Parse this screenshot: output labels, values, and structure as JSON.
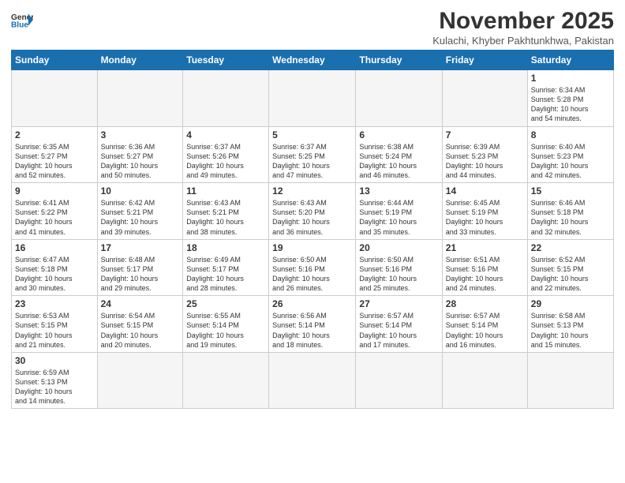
{
  "header": {
    "logo_general": "General",
    "logo_blue": "Blue",
    "month": "November 2025",
    "location": "Kulachi, Khyber Pakhtunkhwa, Pakistan"
  },
  "days_of_week": [
    "Sunday",
    "Monday",
    "Tuesday",
    "Wednesday",
    "Thursday",
    "Friday",
    "Saturday"
  ],
  "weeks": [
    [
      {
        "day": "",
        "info": ""
      },
      {
        "day": "",
        "info": ""
      },
      {
        "day": "",
        "info": ""
      },
      {
        "day": "",
        "info": ""
      },
      {
        "day": "",
        "info": ""
      },
      {
        "day": "",
        "info": ""
      },
      {
        "day": "1",
        "info": "Sunrise: 6:34 AM\nSunset: 5:28 PM\nDaylight: 10 hours\nand 54 minutes."
      }
    ],
    [
      {
        "day": "2",
        "info": "Sunrise: 6:35 AM\nSunset: 5:27 PM\nDaylight: 10 hours\nand 52 minutes."
      },
      {
        "day": "3",
        "info": "Sunrise: 6:36 AM\nSunset: 5:27 PM\nDaylight: 10 hours\nand 50 minutes."
      },
      {
        "day": "4",
        "info": "Sunrise: 6:37 AM\nSunset: 5:26 PM\nDaylight: 10 hours\nand 49 minutes."
      },
      {
        "day": "5",
        "info": "Sunrise: 6:37 AM\nSunset: 5:25 PM\nDaylight: 10 hours\nand 47 minutes."
      },
      {
        "day": "6",
        "info": "Sunrise: 6:38 AM\nSunset: 5:24 PM\nDaylight: 10 hours\nand 46 minutes."
      },
      {
        "day": "7",
        "info": "Sunrise: 6:39 AM\nSunset: 5:23 PM\nDaylight: 10 hours\nand 44 minutes."
      },
      {
        "day": "8",
        "info": "Sunrise: 6:40 AM\nSunset: 5:23 PM\nDaylight: 10 hours\nand 42 minutes."
      }
    ],
    [
      {
        "day": "9",
        "info": "Sunrise: 6:41 AM\nSunset: 5:22 PM\nDaylight: 10 hours\nand 41 minutes."
      },
      {
        "day": "10",
        "info": "Sunrise: 6:42 AM\nSunset: 5:21 PM\nDaylight: 10 hours\nand 39 minutes."
      },
      {
        "day": "11",
        "info": "Sunrise: 6:43 AM\nSunset: 5:21 PM\nDaylight: 10 hours\nand 38 minutes."
      },
      {
        "day": "12",
        "info": "Sunrise: 6:43 AM\nSunset: 5:20 PM\nDaylight: 10 hours\nand 36 minutes."
      },
      {
        "day": "13",
        "info": "Sunrise: 6:44 AM\nSunset: 5:19 PM\nDaylight: 10 hours\nand 35 minutes."
      },
      {
        "day": "14",
        "info": "Sunrise: 6:45 AM\nSunset: 5:19 PM\nDaylight: 10 hours\nand 33 minutes."
      },
      {
        "day": "15",
        "info": "Sunrise: 6:46 AM\nSunset: 5:18 PM\nDaylight: 10 hours\nand 32 minutes."
      }
    ],
    [
      {
        "day": "16",
        "info": "Sunrise: 6:47 AM\nSunset: 5:18 PM\nDaylight: 10 hours\nand 30 minutes."
      },
      {
        "day": "17",
        "info": "Sunrise: 6:48 AM\nSunset: 5:17 PM\nDaylight: 10 hours\nand 29 minutes."
      },
      {
        "day": "18",
        "info": "Sunrise: 6:49 AM\nSunset: 5:17 PM\nDaylight: 10 hours\nand 28 minutes."
      },
      {
        "day": "19",
        "info": "Sunrise: 6:50 AM\nSunset: 5:16 PM\nDaylight: 10 hours\nand 26 minutes."
      },
      {
        "day": "20",
        "info": "Sunrise: 6:50 AM\nSunset: 5:16 PM\nDaylight: 10 hours\nand 25 minutes."
      },
      {
        "day": "21",
        "info": "Sunrise: 6:51 AM\nSunset: 5:16 PM\nDaylight: 10 hours\nand 24 minutes."
      },
      {
        "day": "22",
        "info": "Sunrise: 6:52 AM\nSunset: 5:15 PM\nDaylight: 10 hours\nand 22 minutes."
      }
    ],
    [
      {
        "day": "23",
        "info": "Sunrise: 6:53 AM\nSunset: 5:15 PM\nDaylight: 10 hours\nand 21 minutes."
      },
      {
        "day": "24",
        "info": "Sunrise: 6:54 AM\nSunset: 5:15 PM\nDaylight: 10 hours\nand 20 minutes."
      },
      {
        "day": "25",
        "info": "Sunrise: 6:55 AM\nSunset: 5:14 PM\nDaylight: 10 hours\nand 19 minutes."
      },
      {
        "day": "26",
        "info": "Sunrise: 6:56 AM\nSunset: 5:14 PM\nDaylight: 10 hours\nand 18 minutes."
      },
      {
        "day": "27",
        "info": "Sunrise: 6:57 AM\nSunset: 5:14 PM\nDaylight: 10 hours\nand 17 minutes."
      },
      {
        "day": "28",
        "info": "Sunrise: 6:57 AM\nSunset: 5:14 PM\nDaylight: 10 hours\nand 16 minutes."
      },
      {
        "day": "29",
        "info": "Sunrise: 6:58 AM\nSunset: 5:13 PM\nDaylight: 10 hours\nand 15 minutes."
      }
    ],
    [
      {
        "day": "30",
        "info": "Sunrise: 6:59 AM\nSunset: 5:13 PM\nDaylight: 10 hours\nand 14 minutes."
      },
      {
        "day": "",
        "info": ""
      },
      {
        "day": "",
        "info": ""
      },
      {
        "day": "",
        "info": ""
      },
      {
        "day": "",
        "info": ""
      },
      {
        "day": "",
        "info": ""
      },
      {
        "day": "",
        "info": ""
      }
    ]
  ]
}
